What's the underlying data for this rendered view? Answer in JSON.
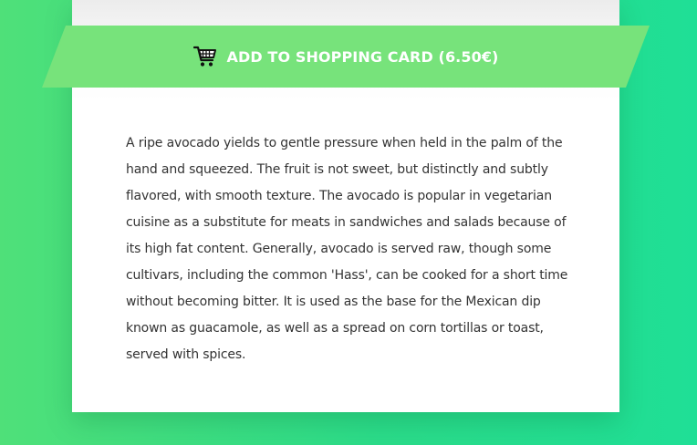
{
  "product": {
    "cart_button": {
      "icon": "shopping-cart-icon",
      "label": "ADD TO SHOPPING CARD (6.50€)"
    },
    "description": "A ripe avocado yields to gentle pressure when held in the palm of the hand and squeezed. The fruit is not sweet, but distinctly and subtly flavored, with smooth texture. The avocado is popular in vegetarian cuisine as a substitute for meats in sandwiches and salads because of its high fat content. Generally, avocado is served raw, though some cultivars, including the common 'Hass', can be cooked for a short time without becoming bitter. It is used as the base for the Mexican dip known as guacamole, as well as a spread on corn tortillas or toast, served with spices."
  },
  "colors": {
    "background_start": "#4fe079",
    "background_end": "#1fdf96",
    "button": "#77e37b",
    "card": "#ffffff",
    "text": "#333333"
  }
}
